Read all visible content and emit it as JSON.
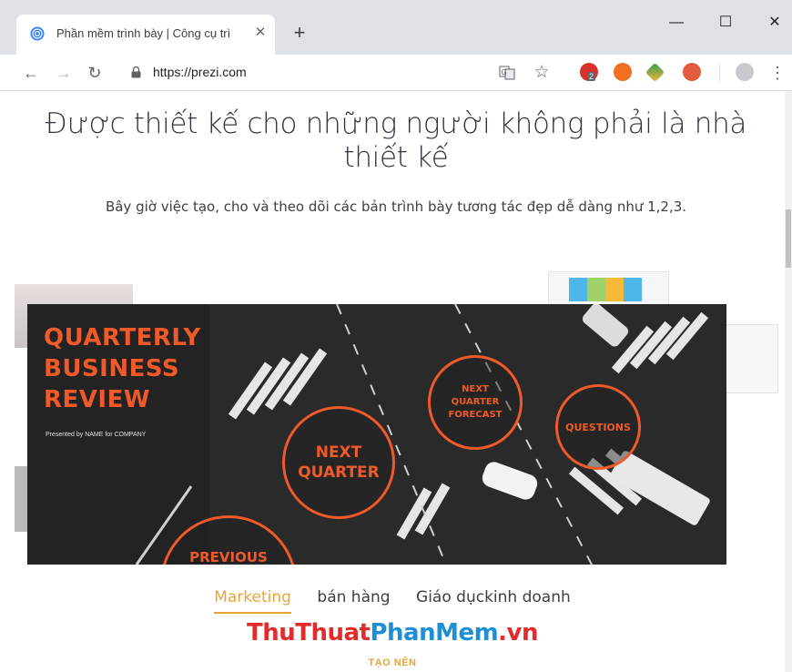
{
  "browser": {
    "tab_title": "Phần mềm trình bày | Công cụ trì",
    "tab_close": "✕",
    "new_tab": "+",
    "window": {
      "minimize": "—",
      "maximize": "☐",
      "close": "✕"
    },
    "url": "https://prezi.com",
    "nav": {
      "back": "←",
      "forward": "→",
      "reload": "↻"
    },
    "bookmark_star": "☆",
    "menu": "⋮",
    "extension_badge": "2"
  },
  "hero": {
    "title_line1": "Được thiết kế cho những người không phải là nhà",
    "title_line2": "thiết kế",
    "subtitle": "Bây giờ việc tạo, cho và theo dõi các bản trình bày tương tác đẹp dễ dàng như 1,2,3."
  },
  "slide": {
    "heading": [
      "QUARTERLY",
      "BUSINESS",
      "REVIEW"
    ],
    "caption": "Presented by NAME for COMPANY",
    "circles": {
      "next_quarter": "NEXT QUARTER",
      "forecast": "NEXT QUARTER FORECAST",
      "questions": "QUESTIONS",
      "previous": "PREVIOUS"
    }
  },
  "categories": [
    {
      "label": "Marketing",
      "active": true
    },
    {
      "label": "bán hàng",
      "active": false
    },
    {
      "label": "Giáo dục",
      "active": false
    },
    {
      "label": "kinh doanh",
      "active": false
    }
  ],
  "watermark": {
    "part1": "ThuThuat",
    "part2": "PhanMem",
    "part3": ".vn"
  },
  "made_by": "TẠO NÊN",
  "colors": {
    "accent": "#ef5a2a",
    "tab_active": "#e8a33a"
  }
}
